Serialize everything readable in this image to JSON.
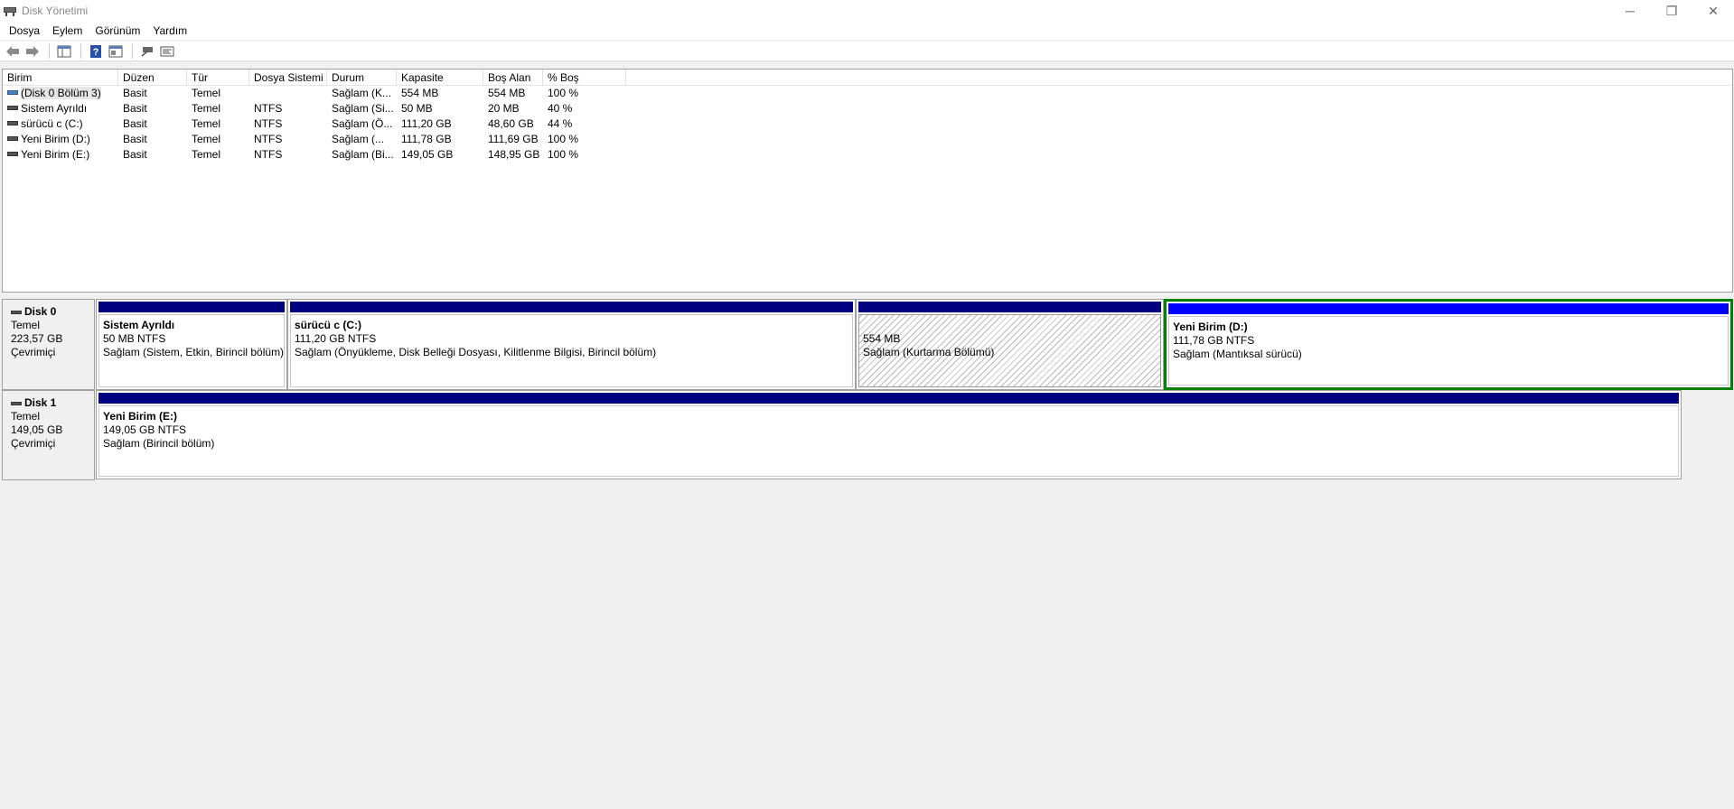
{
  "window": {
    "title": "Disk Yönetimi",
    "controls": {
      "minimize": "─",
      "restore": "❐",
      "close": "✕"
    }
  },
  "menu": [
    "Dosya",
    "Eylem",
    "Görünüm",
    "Yardım"
  ],
  "toolbar": {
    "buttons": [
      "back-icon",
      "forward-icon",
      "console-tree-icon",
      "help-icon",
      "properties-icon",
      "connect-icon",
      "settings-icon"
    ]
  },
  "volume_list": {
    "columns": [
      "Birim",
      "Düzen",
      "Tür",
      "Dosya Sistemi",
      "Durum",
      "Kapasite",
      "Boş Alan",
      "% Boş"
    ],
    "rows": [
      [
        "(Disk 0 Bölüm 3)",
        "Basit",
        "Temel",
        "",
        "Sağlam (K...",
        "554 MB",
        "554 MB",
        "100 %"
      ],
      [
        "Sistem Ayrıldı",
        "Basit",
        "Temel",
        "NTFS",
        "Sağlam (Si...",
        "50 MB",
        "20 MB",
        "40 %"
      ],
      [
        "sürücü c (C:)",
        "Basit",
        "Temel",
        "NTFS",
        "Sağlam (Ö...",
        "111,20 GB",
        "48,60 GB",
        "44 %"
      ],
      [
        "Yeni Birim (D:)",
        "Basit",
        "Temel",
        "NTFS",
        "Sağlam (...",
        "111,78 GB",
        "111,69 GB",
        "100 %"
      ],
      [
        "Yeni Birim (E:)",
        "Basit",
        "Temel",
        "NTFS",
        "Sağlam (Bi...",
        "149,05 GB",
        "148,95 GB",
        "100 %"
      ]
    ]
  },
  "disks": [
    {
      "name": "Disk 0",
      "type": "Temel",
      "size": "223,57 GB",
      "status": "Çevrimiçi",
      "partitions": [
        {
          "title": "Sistem Ayrıldı",
          "size": "50 MB NTFS",
          "status": "Sağlam (Sistem, Etkin, Birincil bölüm)"
        },
        {
          "title": "sürücü c  (C:)",
          "size": "111,20 GB NTFS",
          "status": "Sağlam (Önyükleme, Disk Belleği Dosyası, Kilitlenme Bilgisi, Birincil bölüm)"
        },
        {
          "title": "",
          "size": "554 MB",
          "status": "Sağlam (Kurtarma Bölümü)"
        },
        {
          "title": "Yeni Birim  (D:)",
          "size": "111,78 GB NTFS",
          "status": "Sağlam (Mantıksal sürücü)"
        }
      ]
    },
    {
      "name": "Disk 1",
      "type": "Temel",
      "size": "149,05 GB",
      "status": "Çevrimiçi",
      "partitions": [
        {
          "title": "Yeni Birim  (E:)",
          "size": "149,05 GB NTFS",
          "status": "Sağlam (Birincil bölüm)"
        }
      ]
    }
  ]
}
